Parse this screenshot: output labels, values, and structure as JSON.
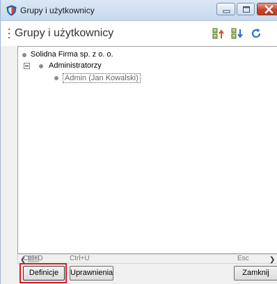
{
  "window": {
    "title": "Grupy i użytkownicy",
    "icon": "shield-icon",
    "controls": [
      "minimize-icon",
      "maximize-icon",
      "close-icon"
    ]
  },
  "header": {
    "title": "Grupy i użytkownicy",
    "tools": [
      "export-icon",
      "import-icon",
      "refresh-icon"
    ]
  },
  "tree": {
    "items": [
      {
        "label": "Solidna Firma sp. z o. o."
      },
      {
        "label": "Administratorzy"
      },
      {
        "label": "Admin (Jan Kowalski)"
      }
    ]
  },
  "shortcuts": {
    "definicje": "Ctrl+D",
    "uprawnienia": "Ctrl+U",
    "zamknij": "Esc"
  },
  "buttons": {
    "definicje": "Definicje",
    "uprawnienia": "Uprawnienia",
    "zamknij": "Zamknij"
  },
  "colors": {
    "highlight": "#e01a22",
    "accent_blue": "#2a6fc9"
  }
}
